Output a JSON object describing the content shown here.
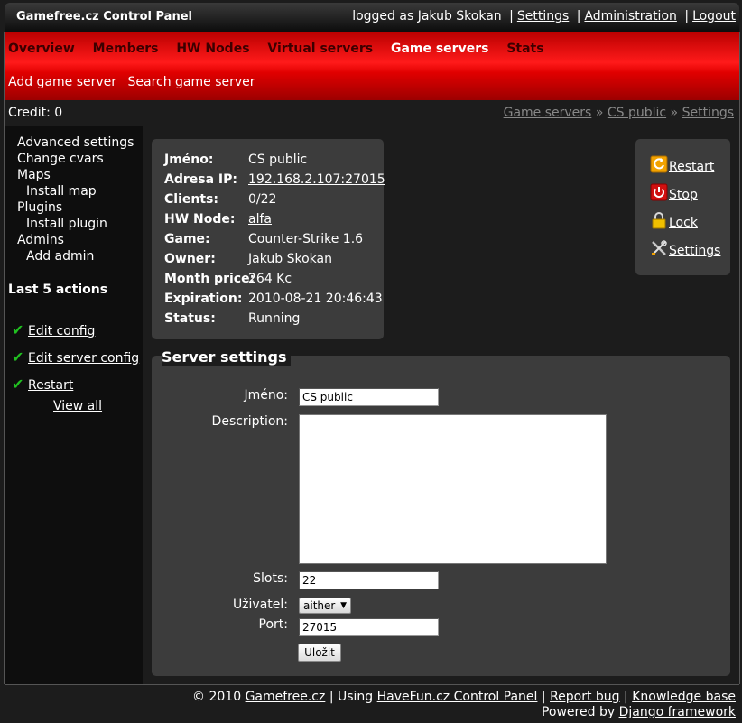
{
  "header": {
    "title": "Gamefree.cz Control Panel",
    "logged_as": "logged as Jakub Skokan",
    "settings": "Settings",
    "administration": "Administration",
    "logout": "Logout",
    "separator": "|"
  },
  "nav": {
    "items": [
      "Overview",
      "Members",
      "HW Nodes",
      "Virtual servers",
      "Game servers",
      "Stats"
    ],
    "active": "Game servers",
    "sub": [
      "Add game server",
      "Search game server"
    ]
  },
  "credit": "Credit: 0",
  "breadcrumb": {
    "items": [
      "Game servers",
      "CS public",
      "Settings"
    ],
    "separator": "»"
  },
  "sidebar": {
    "items": [
      {
        "label": "Advanced settings",
        "level": 0
      },
      {
        "label": "Change cvars",
        "level": 0
      },
      {
        "label": "Maps",
        "level": 0
      },
      {
        "label": "Install map",
        "level": 1
      },
      {
        "label": "Plugins",
        "level": 0
      },
      {
        "label": "Install plugin",
        "level": 1
      },
      {
        "label": "Admins",
        "level": 0
      },
      {
        "label": "Add admin",
        "level": 1
      }
    ],
    "last_actions_title": "Last 5 actions",
    "actions": [
      "Edit config",
      "Edit server config",
      "Restart"
    ],
    "view_all": "View all",
    "check_icon": "check-icon",
    "check_color": "#20c020"
  },
  "server_info": {
    "rows": [
      {
        "label": "Jméno:",
        "value": "CS public",
        "link": false
      },
      {
        "label": "Adresa IP:",
        "value": "192.168.2.107:27015",
        "link": true
      },
      {
        "label": "Clients:",
        "value": "0/22",
        "link": false
      },
      {
        "label": "HW Node:",
        "value": "alfa",
        "link": true
      },
      {
        "label": "Game:",
        "value": "Counter-Strike 1.6",
        "link": false
      },
      {
        "label": "Owner:",
        "value": "Jakub Skokan",
        "link": true
      },
      {
        "label": "Month price:",
        "value": "264 Kc",
        "link": false
      },
      {
        "label": "Expiration:",
        "value": "2010-08-21 20:46:43",
        "link": false
      },
      {
        "label": "Status:",
        "value": "Running",
        "link": false
      }
    ]
  },
  "actions": {
    "restart": "Restart",
    "stop": "Stop",
    "lock": "Lock",
    "settings": "Settings"
  },
  "form": {
    "title": "Server settings",
    "name_label": "Jméno:",
    "name_value": "CS public",
    "description_label": "Description:",
    "description_value": "",
    "slots_label": "Slots:",
    "slots_value": "22",
    "user_label": "Uživatel:",
    "user_value": "aither",
    "port_label": "Port:",
    "port_value": "27015",
    "submit": "Uložit"
  },
  "footer": {
    "copyright": "© 2010",
    "gamefree": "Gamefree.cz",
    "using": "| Using",
    "havefun": "HaveFun.cz Control Panel",
    "sep": "|",
    "report_bug": "Report bug",
    "knowledge_base": "Knowledge base",
    "powered_by": "Powered by",
    "django": "Django framework"
  },
  "colors": {
    "nav_red": "#ff1a1a",
    "nav_inactive_text": "#3c0000",
    "panel_bg": "#3c3c3c",
    "page_bg": "#1c1c1c"
  }
}
